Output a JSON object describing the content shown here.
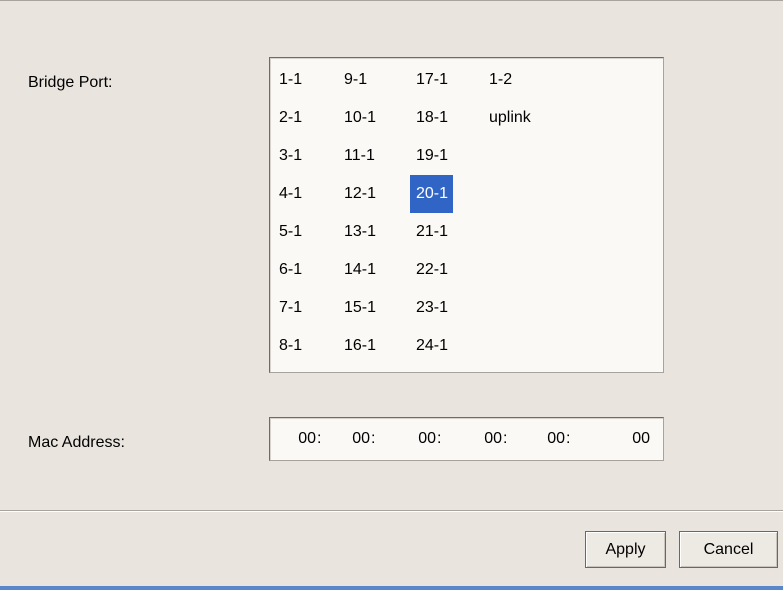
{
  "form": {
    "bridge_port_label": "Bridge Port:",
    "mac_address_label": "Mac Address:"
  },
  "bridge_port_list": {
    "selected": "20-1",
    "columns": [
      [
        "1-1",
        "2-1",
        "3-1",
        "4-1",
        "5-1",
        "6-1",
        "7-1",
        "8-1"
      ],
      [
        "9-1",
        "10-1",
        "11-1",
        "12-1",
        "13-1",
        "14-1",
        "15-1",
        "16-1"
      ],
      [
        "17-1",
        "18-1",
        "19-1",
        "20-1",
        "21-1",
        "22-1",
        "23-1",
        "24-1"
      ],
      [
        "1-2",
        "uplink"
      ]
    ]
  },
  "mac_address": {
    "octets": [
      "00",
      "00",
      "00",
      "00",
      "00",
      "00"
    ],
    "separator": ":"
  },
  "buttons": {
    "apply_label": "Apply",
    "cancel_label": "Cancel"
  },
  "colors": {
    "background": "#e9e4dd",
    "selection": "#3165c5",
    "bottom_bar": "#5b86c9"
  }
}
